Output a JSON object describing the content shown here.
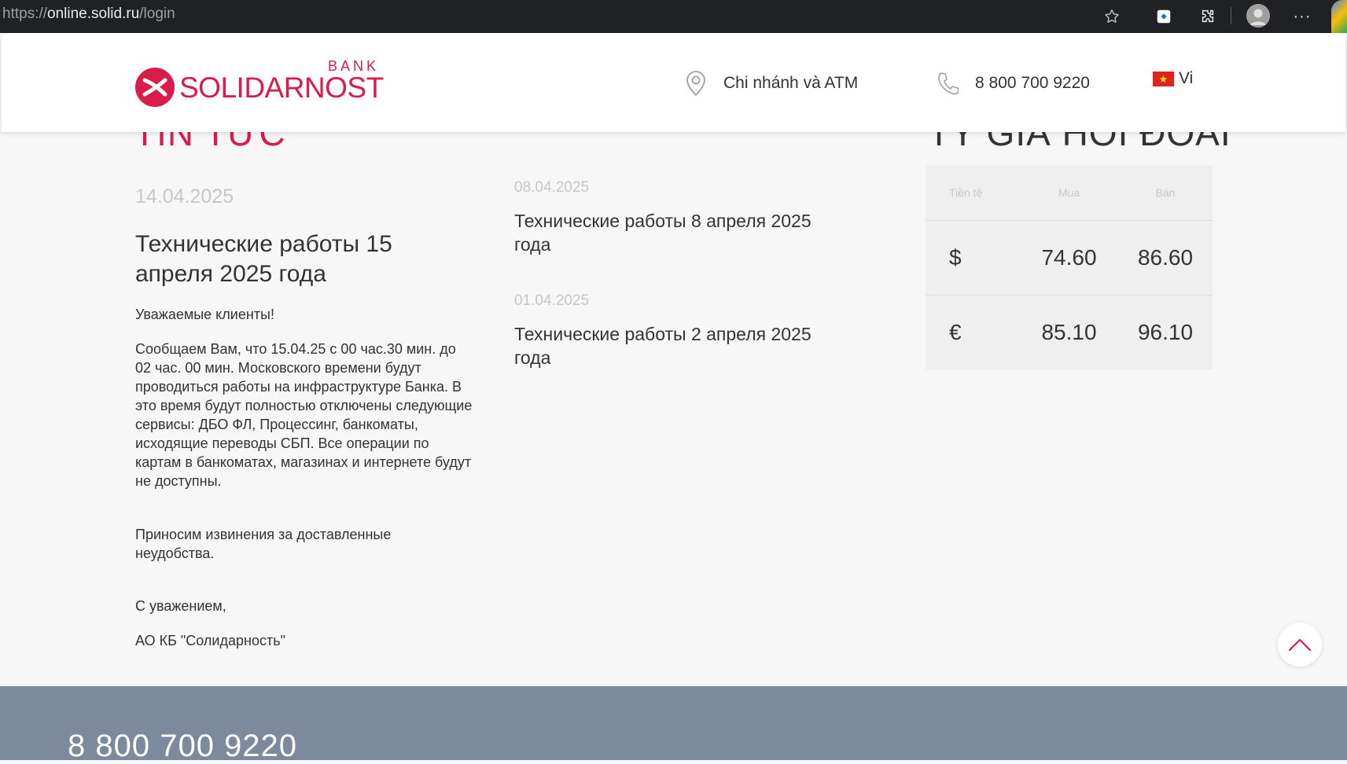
{
  "browser": {
    "url_scheme": "https://",
    "url_host": "online.solid.ru",
    "url_path": "/login",
    "more_label": "···"
  },
  "header": {
    "logo_bank": "BANK",
    "logo_name": "SOLIDARNOST",
    "branch_label": "Chi nhánh và ATM",
    "phone": "8 800 700 9220",
    "language": "Vi"
  },
  "news": {
    "title": "TIN TỨC",
    "main": {
      "date": "14.04.2025",
      "headline": "Технические работы 15 апреля 2025 года",
      "greeting": "Уважаемые клиенты!",
      "body": "Сообщаем Вам, что 15.04.25 с 00 час.30 мин. до 02 час. 00 мин. Московского времени будут проводиться работы на инфраструктуре Банка. В это время будут полностью отключены следующие сервисы: ДБО ФЛ, Процессинг, банкоматы, исходящие переводы СБП. Все операции по картам в банкоматах, магазинах и интернете будут не доступны.",
      "apology": "Приносим извинения за доставленные неудобства.",
      "signoff": "С уважением,",
      "signature": "АО КБ \"Солидарность\""
    },
    "items": [
      {
        "date": "08.04.2025",
        "headline": "Технические работы 8 апреля 2025 года"
      },
      {
        "date": "01.04.2025",
        "headline": "Технические работы 2 апреля 2025 года"
      }
    ]
  },
  "rates": {
    "title": "TỶ GIÁ HỐI ĐOÁI",
    "headers": {
      "currency": "Tiền tệ",
      "buy": "Mua",
      "sell": "Bán"
    },
    "rows": [
      {
        "symbol": "$",
        "buy": "74.60",
        "sell": "86.60"
      },
      {
        "symbol": "€",
        "buy": "85.10",
        "sell": "96.10"
      }
    ]
  },
  "footer": {
    "phone": "8 800 700 9220"
  },
  "colors": {
    "brand": "#d91c4a",
    "footer_bg": "#7b8a9c",
    "page_bg": "#f7f7f7"
  }
}
